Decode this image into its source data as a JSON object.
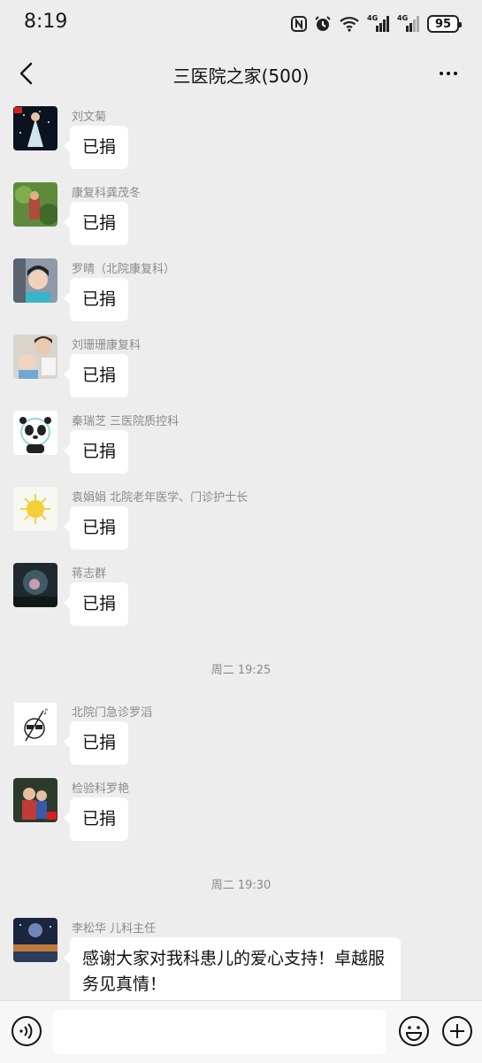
{
  "status": {
    "time": "8:19",
    "battery": "95",
    "network1": "4G",
    "network2": "4G"
  },
  "nav": {
    "title": "三医院之家(500)"
  },
  "messages": [
    {
      "sender": "刘文菊",
      "text": "已捐"
    },
    {
      "sender": "康复科龚茂冬",
      "text": "已捐"
    },
    {
      "sender": "罗晴（北院康复科）",
      "text": "已捐"
    },
    {
      "sender": "刘珊珊康复科",
      "text": "已捐"
    },
    {
      "sender": "秦瑞芝  三医院质控科",
      "text": "已捐"
    },
    {
      "sender": "袁娟娟  北院老年医学、门诊护士长",
      "text": "已捐"
    },
    {
      "sender": "蒋志群",
      "text": "已捐"
    },
    {
      "sender": "北院门急诊罗滔",
      "text": "已捐"
    },
    {
      "sender": "检验科罗艳",
      "text": "已捐"
    },
    {
      "sender": "李松华  儿科主任",
      "text": "感谢大家对我科患儿的爱心支持！卓越服务见真情！"
    }
  ],
  "timestamps": [
    "周二 19:25",
    "周二 19:30"
  ],
  "colors": {
    "background": "#ededed",
    "bubble": "#ffffff",
    "meta_text": "#8a8a8a"
  }
}
